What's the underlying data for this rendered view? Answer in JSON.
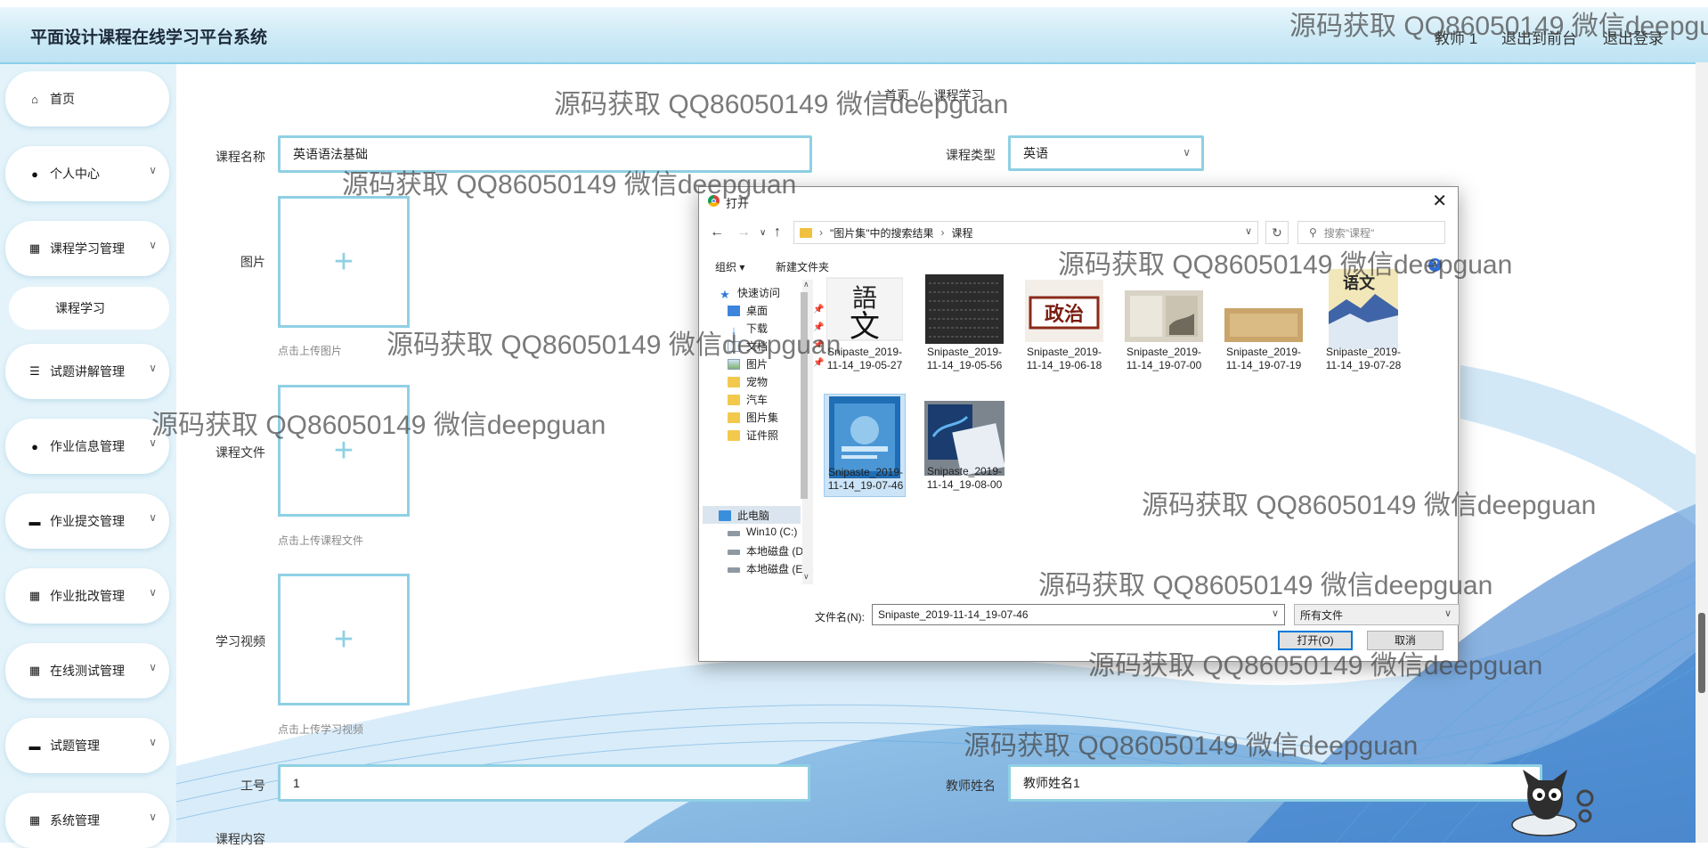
{
  "header": {
    "title": "平面设计课程在线学习平台系统",
    "user": "教师 1",
    "back_to_front": "退出到前台",
    "logout": "退出登录"
  },
  "sidebar": {
    "items": [
      {
        "label": "首页",
        "icon": "home-icon"
      },
      {
        "label": "个人中心",
        "icon": "user-icon"
      },
      {
        "label": "课程学习管理",
        "icon": "grid-icon"
      },
      {
        "label": "试题讲解管理",
        "icon": "list-icon"
      },
      {
        "label": "作业信息管理",
        "icon": "user-icon"
      },
      {
        "label": "作业提交管理",
        "icon": "monitor-icon"
      },
      {
        "label": "作业批改管理",
        "icon": "grid-icon"
      },
      {
        "label": "在线测试管理",
        "icon": "grid-icon"
      },
      {
        "label": "试题管理",
        "icon": "monitor-icon"
      },
      {
        "label": "系统管理",
        "icon": "grid-icon"
      }
    ],
    "submenu": "课程学习"
  },
  "breadcrumb": {
    "home": "首页",
    "separator": "//",
    "current": "课程学习"
  },
  "form": {
    "course_name_label": "课程名称",
    "course_name_value": "英语语法基础",
    "course_type_label": "课程类型",
    "course_type_value": "英语",
    "image_label": "图片",
    "image_hint": "点击上传图片",
    "file_label": "课程文件",
    "file_hint": "点击上传课程文件",
    "video_label": "学习视频",
    "video_hint": "点击上传学习视频",
    "job_no_label": "工号",
    "job_no_value": "1",
    "teacher_name_label": "教师姓名",
    "teacher_name_value": "教师姓名1",
    "content_label": "课程内容"
  },
  "watermark": "源码获取 QQ86050149 微信deepguan",
  "dialog": {
    "title": "打开",
    "path": [
      "\"图片集\"中的搜索结果",
      "课程"
    ],
    "search_placeholder": "搜索\"课程\"",
    "organize": "组织 ▾",
    "new_folder": "新建文件夹",
    "nav": [
      {
        "label": "快速访问",
        "icon": "star-icon"
      },
      {
        "label": "桌面",
        "icon": "desktop-icon"
      },
      {
        "label": "下载",
        "icon": "download-icon"
      },
      {
        "label": "文档",
        "icon": "document-icon"
      },
      {
        "label": "图片",
        "icon": "picture-icon"
      },
      {
        "label": "宠物",
        "icon": "folder-icon"
      },
      {
        "label": "汽车",
        "icon": "folder-icon"
      },
      {
        "label": "图片集",
        "icon": "folder-icon"
      },
      {
        "label": "证件照",
        "icon": "folder-icon"
      },
      {
        "label": "此电脑",
        "icon": "computer-icon"
      },
      {
        "label": "Win10 (C:)",
        "icon": "drive-icon"
      },
      {
        "label": "本地磁盘 (D:)",
        "icon": "drive-icon"
      },
      {
        "label": "本地磁盘 (E:)",
        "icon": "drive-icon"
      }
    ],
    "files": [
      {
        "l1": "Snipaste_2019-",
        "l2": "11-14_19-05-27"
      },
      {
        "l1": "Snipaste_2019-",
        "l2": "11-14_19-05-56"
      },
      {
        "l1": "Snipaste_2019-",
        "l2": "11-14_19-06-18"
      },
      {
        "l1": "Snipaste_2019-",
        "l2": "11-14_19-07-00"
      },
      {
        "l1": "Snipaste_2019-",
        "l2": "11-14_19-07-19"
      },
      {
        "l1": "Snipaste_2019-",
        "l2": "11-14_19-07-28"
      },
      {
        "l1": "Snipaste_2019-",
        "l2": "11-14_19-07-46"
      },
      {
        "l1": "Snipaste_2019-",
        "l2": "11-14_19-08-00"
      }
    ],
    "filename_label": "文件名(N):",
    "filename_value": "Snipaste_2019-11-14_19-07-46",
    "filetype_value": "所有文件",
    "open_button": "打开(O)",
    "cancel_button": "取消"
  },
  "colors": {
    "accent": "#8fd0e4",
    "header_bg": "#cdeaf6",
    "sidebar_bg": "#e4f3fa",
    "selection": "#cce4f7"
  }
}
